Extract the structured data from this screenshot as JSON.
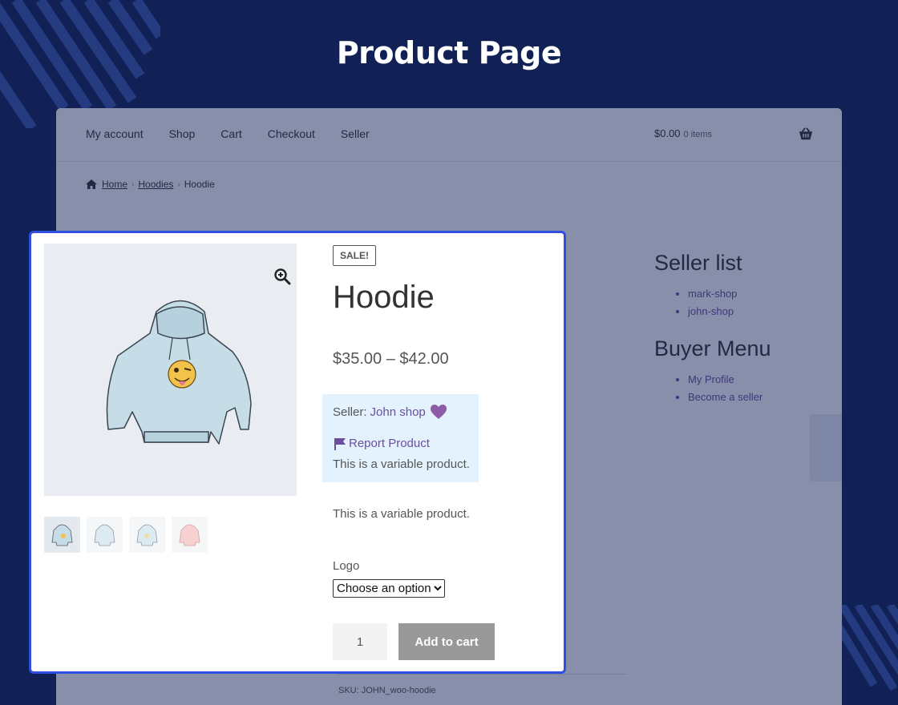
{
  "page": {
    "title": "Product Page"
  },
  "nav": {
    "items": [
      "My account",
      "Shop",
      "Cart",
      "Checkout",
      "Seller"
    ],
    "cart_amount": "$0.00",
    "cart_items": "0 items",
    "cart_icon": "basket-icon"
  },
  "breadcrumb": {
    "home": "Home",
    "category": "Hoodies",
    "current": "Hoodie",
    "icon": "home-icon"
  },
  "sidebar": {
    "seller_list_title": "Seller list",
    "sellers": [
      "mark-shop",
      "john-shop"
    ],
    "buyer_menu_title": "Buyer Menu",
    "buyer_items": [
      "My Profile",
      "Become a seller"
    ]
  },
  "product": {
    "sale_badge": "SALE!",
    "title": "Hoodie",
    "price": "$35.00 – $42.00",
    "seller_label": "Seller:",
    "seller_name": "John shop",
    "report_label": "Report Product",
    "vendor_desc": "This is a variable product.",
    "short_desc": "This is a variable product.",
    "variation_label": "Logo",
    "variation_selected": "Choose an option",
    "quantity": "1",
    "add_to_cart": "Add to cart",
    "sku": "SKU: JOHN_woo-hoodie"
  },
  "colors": {
    "background": "#112055",
    "accent_border": "#2f4fe0",
    "link": "#6b4ea0",
    "vendor_box": "#e3f2fd"
  }
}
